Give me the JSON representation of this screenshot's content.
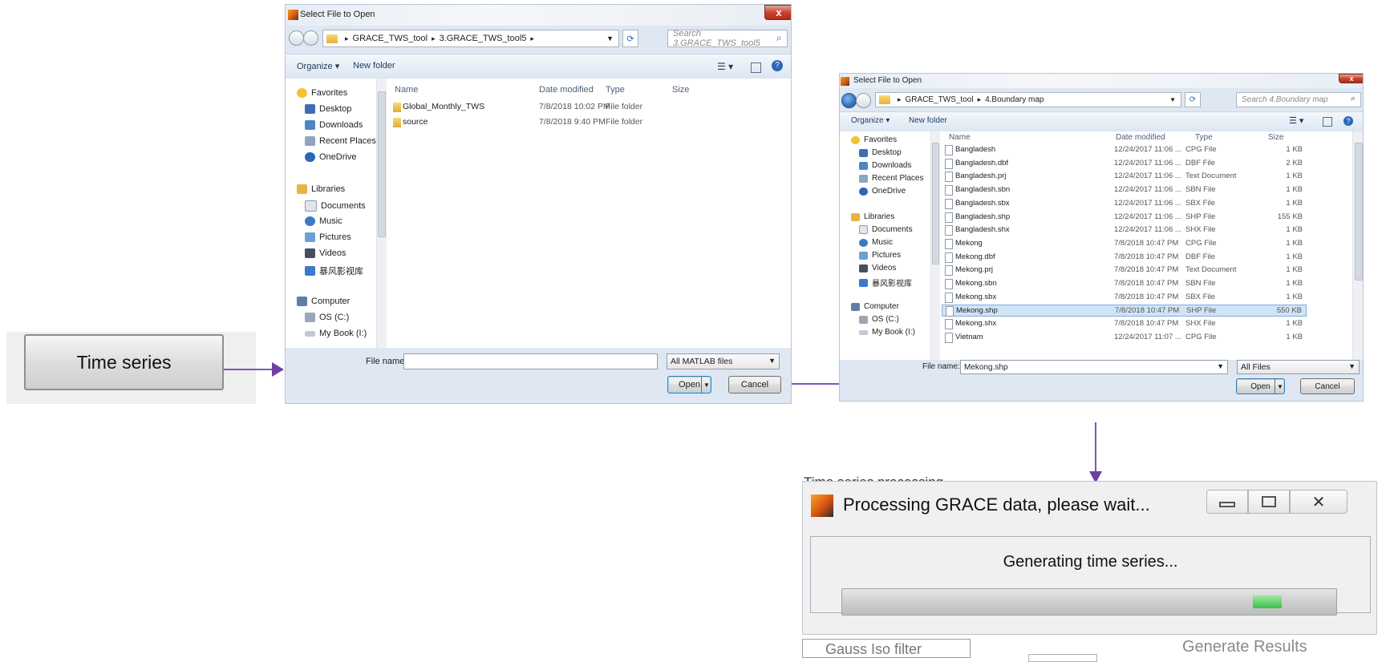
{
  "time_series_button": {
    "label": "Time series"
  },
  "dialog1": {
    "title": "Select File to Open",
    "close": "x",
    "path": [
      "GRACE_TWS_tool",
      "3.GRACE_TWS_tool5"
    ],
    "search_placeholder": "Search 3.GRACE_TWS_tool5",
    "toolbar": {
      "organize": "Organize ▾",
      "new_folder": "New folder"
    },
    "nav": {
      "favorites": "Favorites",
      "favorites_items": [
        "Desktop",
        "Downloads",
        "Recent Places",
        "OneDrive"
      ],
      "libraries": "Libraries",
      "library_items": [
        "Documents",
        "Music",
        "Pictures",
        "Videos",
        "暴风影视库"
      ],
      "computer": "Computer",
      "computer_items": [
        "OS (C:)",
        "My Book (I:)"
      ]
    },
    "columns": [
      "Name",
      "Date modified",
      "Type",
      "Size"
    ],
    "files": [
      {
        "name": "Global_Monthly_TWS",
        "date": "7/8/2018 10:02 PM",
        "type": "File folder",
        "size": ""
      },
      {
        "name": "source",
        "date": "7/8/2018 9:40 PM",
        "type": "File folder",
        "size": ""
      }
    ],
    "file_name_label": "File name:",
    "file_name_value": "",
    "file_type": "All MATLAB files",
    "open": "Open",
    "cancel": "Cancel"
  },
  "dialog2": {
    "title": "Select File to Open",
    "close": "x",
    "path": [
      "GRACE_TWS_tool",
      "4.Boundary map"
    ],
    "search_placeholder": "Search 4.Boundary map",
    "toolbar": {
      "organize": "Organize ▾",
      "new_folder": "New folder"
    },
    "nav": {
      "favorites": "Favorites",
      "favorites_items": [
        "Desktop",
        "Downloads",
        "Recent Places",
        "OneDrive"
      ],
      "libraries": "Libraries",
      "library_items": [
        "Documents",
        "Music",
        "Pictures",
        "Videos",
        "暴风影视库"
      ],
      "computer": "Computer",
      "computer_items": [
        "OS (C:)",
        "My Book (I:)"
      ]
    },
    "columns": [
      "Name",
      "Date modified",
      "Type",
      "Size"
    ],
    "files": [
      {
        "name": "Bangladesh",
        "date": "12/24/2017 11:06 ...",
        "type": "CPG File",
        "size": "1 KB"
      },
      {
        "name": "Bangladesh.dbf",
        "date": "12/24/2017 11:06 ...",
        "type": "DBF File",
        "size": "2 KB"
      },
      {
        "name": "Bangladesh.prj",
        "date": "12/24/2017 11:06 ...",
        "type": "Text Document",
        "size": "1 KB"
      },
      {
        "name": "Bangladesh.sbn",
        "date": "12/24/2017 11:06 ...",
        "type": "SBN File",
        "size": "1 KB"
      },
      {
        "name": "Bangladesh.sbx",
        "date": "12/24/2017 11:06 ...",
        "type": "SBX File",
        "size": "1 KB"
      },
      {
        "name": "Bangladesh.shp",
        "date": "12/24/2017 11:06 ...",
        "type": "SHP File",
        "size": "155 KB"
      },
      {
        "name": "Bangladesh.shx",
        "date": "12/24/2017 11:06 ...",
        "type": "SHX File",
        "size": "1 KB"
      },
      {
        "name": "Mekong",
        "date": "7/8/2018 10:47 PM",
        "type": "CPG File",
        "size": "1 KB"
      },
      {
        "name": "Mekong.dbf",
        "date": "7/8/2018 10:47 PM",
        "type": "DBF File",
        "size": "1 KB"
      },
      {
        "name": "Mekong.prj",
        "date": "7/8/2018 10:47 PM",
        "type": "Text Document",
        "size": "1 KB"
      },
      {
        "name": "Mekong.sbn",
        "date": "7/8/2018 10:47 PM",
        "type": "SBN File",
        "size": "1 KB"
      },
      {
        "name": "Mekong.sbx",
        "date": "7/8/2018 10:47 PM",
        "type": "SBX File",
        "size": "1 KB"
      },
      {
        "name": "Mekong.shp",
        "date": "7/8/2018 10:47 PM",
        "type": "SHP File",
        "size": "550 KB"
      },
      {
        "name": "Mekong.shx",
        "date": "7/8/2018 10:47 PM",
        "type": "SHX File",
        "size": "1 KB"
      },
      {
        "name": "Vietnam",
        "date": "12/24/2017 11:07 ...",
        "type": "CPG File",
        "size": "1 KB"
      }
    ],
    "selected_row": 12,
    "file_name_label": "File name:",
    "file_name_value": "Mekong.shp",
    "file_type": "All Files",
    "open": "Open",
    "cancel": "Cancel"
  },
  "background_app": {
    "panel_title": "Time series processing",
    "filter_label": "Gauss  Iso  filter",
    "generate_button": "Generate Results"
  },
  "processing": {
    "title": "Processing GRACE data, please wait...",
    "status": "Generating time series...",
    "progress": 0.89
  }
}
